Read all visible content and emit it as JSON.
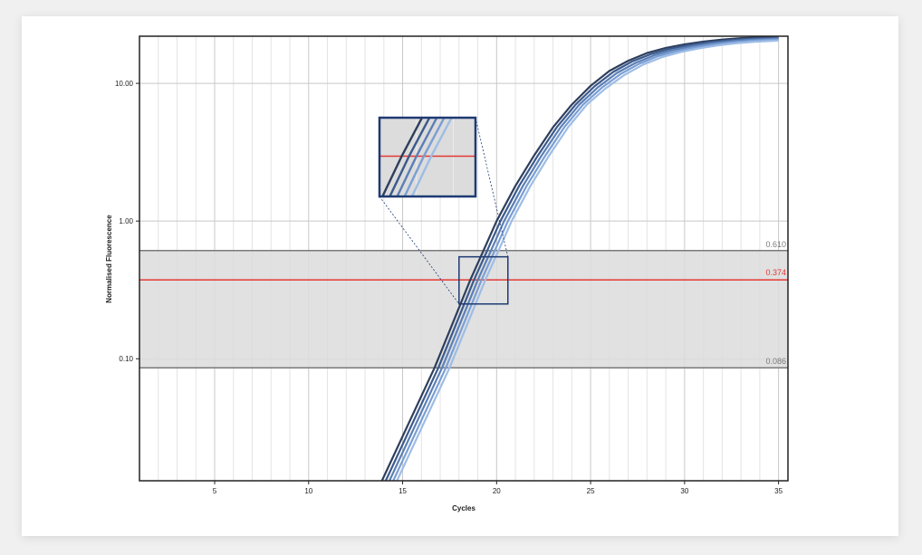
{
  "chart_data": {
    "type": "line",
    "xlabel": "Cycles",
    "ylabel": "Normalised Fluorescence",
    "x_range": [
      1,
      35.5
    ],
    "y_range": [
      0.013,
      22
    ],
    "y_scale": "log",
    "grid": "on",
    "x_ticks": [
      {
        "value": 5,
        "label": "5"
      },
      {
        "value": 10,
        "label": "10"
      },
      {
        "value": 15,
        "label": "15"
      },
      {
        "value": 20,
        "label": "20"
      },
      {
        "value": 25,
        "label": "25"
      },
      {
        "value": 30,
        "label": "30"
      },
      {
        "value": 35,
        "label": "35"
      }
    ],
    "y_ticks": [
      {
        "value": 0.1,
        "label": "0.10"
      },
      {
        "value": 1.0,
        "label": "1.00"
      },
      {
        "value": 10.0,
        "label": "10.00"
      }
    ],
    "threshold_band": {
      "lower": 0.086,
      "upper": 0.61,
      "lower_label": "0.086",
      "upper_label": "0.610"
    },
    "threshold": {
      "value": 0.374,
      "label": "0.374",
      "color": "#e53935"
    },
    "series": [
      {
        "color": "#2e3e5c",
        "points": [
          [
            13.9,
            0.013
          ],
          [
            16.7,
            0.086
          ],
          [
            18.6,
            0.374
          ],
          [
            19.3,
            0.61
          ],
          [
            20.0,
            1.0
          ],
          [
            21.0,
            1.8
          ],
          [
            22.0,
            3.0
          ],
          [
            23.0,
            4.8
          ],
          [
            24.0,
            7.0
          ],
          [
            25.0,
            9.6
          ],
          [
            26.0,
            12.3
          ],
          [
            27.0,
            14.6
          ],
          [
            28.0,
            16.6
          ],
          [
            29.0,
            18.1
          ],
          [
            30.0,
            19.2
          ],
          [
            31.0,
            20.1
          ],
          [
            32.0,
            20.8
          ],
          [
            33.0,
            21.3
          ],
          [
            34.0,
            21.6
          ],
          [
            35.0,
            21.9
          ]
        ]
      },
      {
        "color": "#3b5a8c",
        "points": [
          [
            14.1,
            0.013
          ],
          [
            16.9,
            0.086
          ],
          [
            18.8,
            0.374
          ],
          [
            19.5,
            0.61
          ],
          [
            20.2,
            1.0
          ],
          [
            21.2,
            1.8
          ],
          [
            22.2,
            3.0
          ],
          [
            23.2,
            4.8
          ],
          [
            24.2,
            7.0
          ],
          [
            25.2,
            9.5
          ],
          [
            26.2,
            12.1
          ],
          [
            27.2,
            14.4
          ],
          [
            28.2,
            16.3
          ],
          [
            29.2,
            17.8
          ],
          [
            30.2,
            18.9
          ],
          [
            31.2,
            19.8
          ],
          [
            32.2,
            20.5
          ],
          [
            33.2,
            21.0
          ],
          [
            34.2,
            21.3
          ],
          [
            35.0,
            21.5
          ]
        ]
      },
      {
        "color": "#5b7fb5",
        "points": [
          [
            14.3,
            0.013
          ],
          [
            17.1,
            0.086
          ],
          [
            19.0,
            0.374
          ],
          [
            19.7,
            0.61
          ],
          [
            20.4,
            1.0
          ],
          [
            21.4,
            1.8
          ],
          [
            22.4,
            3.0
          ],
          [
            23.4,
            4.8
          ],
          [
            24.4,
            7.0
          ],
          [
            25.4,
            9.4
          ],
          [
            26.4,
            11.9
          ],
          [
            27.4,
            14.1
          ],
          [
            28.4,
            16.0
          ],
          [
            29.4,
            17.5
          ],
          [
            30.4,
            18.6
          ],
          [
            31.4,
            19.5
          ],
          [
            32.4,
            20.2
          ],
          [
            33.4,
            20.7
          ],
          [
            34.4,
            21.0
          ],
          [
            35.0,
            21.2
          ]
        ]
      },
      {
        "color": "#7a9ed4",
        "points": [
          [
            14.5,
            0.013
          ],
          [
            17.3,
            0.086
          ],
          [
            19.2,
            0.374
          ],
          [
            19.9,
            0.61
          ],
          [
            20.6,
            1.0
          ],
          [
            21.6,
            1.8
          ],
          [
            22.6,
            3.0
          ],
          [
            23.6,
            4.8
          ],
          [
            24.6,
            7.0
          ],
          [
            25.6,
            9.3
          ],
          [
            26.6,
            11.7
          ],
          [
            27.6,
            13.9
          ],
          [
            28.6,
            15.8
          ],
          [
            29.6,
            17.2
          ],
          [
            30.6,
            18.3
          ],
          [
            31.6,
            19.2
          ],
          [
            32.6,
            19.9
          ],
          [
            33.6,
            20.4
          ],
          [
            34.6,
            20.7
          ],
          [
            35.0,
            20.8
          ]
        ]
      },
      {
        "color": "#9dbde6",
        "points": [
          [
            14.7,
            0.013
          ],
          [
            17.5,
            0.086
          ],
          [
            19.4,
            0.374
          ],
          [
            20.1,
            0.61
          ],
          [
            20.8,
            1.0
          ],
          [
            21.8,
            1.8
          ],
          [
            22.8,
            3.0
          ],
          [
            23.8,
            4.8
          ],
          [
            24.8,
            7.0
          ],
          [
            25.8,
            9.2
          ],
          [
            26.8,
            11.5
          ],
          [
            27.8,
            13.7
          ],
          [
            28.8,
            15.5
          ],
          [
            29.8,
            16.9
          ],
          [
            30.8,
            18.0
          ],
          [
            31.8,
            18.9
          ],
          [
            32.8,
            19.6
          ],
          [
            33.8,
            20.1
          ],
          [
            34.8,
            20.4
          ],
          [
            35.0,
            20.5
          ]
        ]
      }
    ],
    "zoom": {
      "x_range": [
        18.0,
        20.6
      ],
      "y_range": [
        0.25,
        0.55
      ]
    }
  },
  "colors": {
    "band_fill": "#dcdcdc",
    "band_line": "#7a7a7a",
    "band_label": "#7a7a7a",
    "zoom_box": "#1f3a73",
    "leader": "#1f3a73"
  }
}
